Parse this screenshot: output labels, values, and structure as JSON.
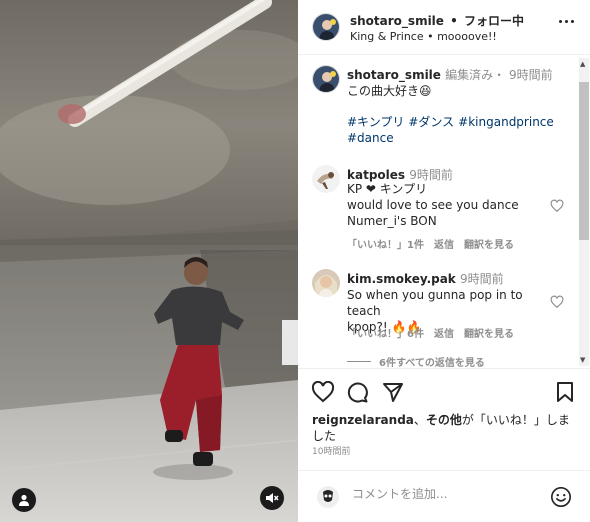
{
  "post": {
    "username": "shotaro_smile",
    "separator": "•",
    "follow_label": "フォロー中",
    "audio": "King & Prince • moooove!!"
  },
  "caption": {
    "username": "shotaro_smile",
    "meta": "編集済み・ 9時間前",
    "text": "この曲大好き😆",
    "hashtags": [
      "#キンプリ",
      "#ダンス",
      "#kingandprince",
      "#dance"
    ]
  },
  "comments": [
    {
      "username": "katpoles",
      "time": "9時間前",
      "lines": [
        "KP ❤ キンプリ",
        "would love to see you dance",
        "Numer_i's BON"
      ],
      "likes": "「いいね！」1件",
      "reply": "返信",
      "translate": "翻訳を見る"
    },
    {
      "username": "kim.smokey.pak",
      "time": "9時間前",
      "lines": [
        "So when you gunna pop in to teach",
        "kpop?! 🔥🔥"
      ],
      "likes": "「いいね！」6件",
      "reply": "返信",
      "translate": "翻訳を見る"
    }
  ],
  "view_replies": "6件すべての返信を見る",
  "likes_line": {
    "user": "reignzelaranda",
    "joiner": "、",
    "others": "その他",
    "suffix": "が「いいね！」しました"
  },
  "timestamp": "10時間前",
  "comment_input": {
    "placeholder": "コメントを追加..."
  },
  "icons": {
    "more": "more-options-icon",
    "like": "heart-icon",
    "comment": "comment-icon",
    "share": "share-icon",
    "save": "bookmark-icon",
    "emoji": "emoji-icon",
    "mute": "muted-speaker-icon",
    "tag": "user-tag-icon"
  },
  "colors": {
    "link": "#00376b",
    "meta": "#8e8e8e",
    "pants": "#9b1f2a"
  }
}
